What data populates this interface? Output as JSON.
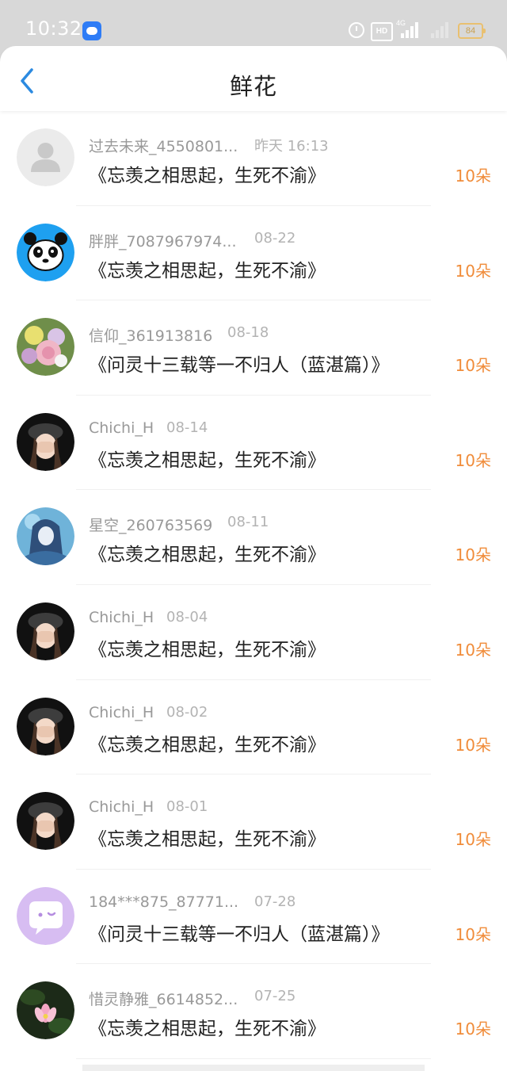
{
  "status_bar": {
    "time": "10:32",
    "network_label": "4G",
    "battery_level": "84",
    "hd_label": "HD"
  },
  "header": {
    "title": "鲜花"
  },
  "colors": {
    "accent_back": "#2c8ae0",
    "flower_count": "#f08c3a",
    "status_bar_bg": "#d8d8d8"
  },
  "items": [
    {
      "user": "过去未来_4550801...",
      "time": "昨天 16:13",
      "book": "《忘羡之相思起，生死不渝》",
      "count": "10朵",
      "avatar_icon": "default-user-avatar"
    },
    {
      "user": "胖胖_7087967974...",
      "time": "08-22",
      "book": "《忘羡之相思起，生死不渝》",
      "count": "10朵",
      "avatar_icon": "panda-avatar"
    },
    {
      "user": "信仰_361913816",
      "time": "08-18",
      "book": "《问灵十三载等一不归人（蓝湛篇）》",
      "count": "10朵",
      "avatar_icon": "flowers-avatar"
    },
    {
      "user": "Chichi_H",
      "time": "08-14",
      "book": "《忘羡之相思起，生死不渝》",
      "count": "10朵",
      "avatar_icon": "girl-cap-avatar"
    },
    {
      "user": "星空_260763569",
      "time": "08-11",
      "book": "《忘羡之相思起，生死不渝》",
      "count": "10朵",
      "avatar_icon": "anime-girl-avatar"
    },
    {
      "user": "Chichi_H",
      "time": "08-04",
      "book": "《忘羡之相思起，生死不渝》",
      "count": "10朵",
      "avatar_icon": "girl-cap-avatar"
    },
    {
      "user": "Chichi_H",
      "time": "08-02",
      "book": "《忘羡之相思起，生死不渝》",
      "count": "10朵",
      "avatar_icon": "girl-cap-avatar"
    },
    {
      "user": "Chichi_H",
      "time": "08-01",
      "book": "《忘羡之相思起，生死不渝》",
      "count": "10朵",
      "avatar_icon": "girl-cap-avatar"
    },
    {
      "user": "184***875_87771...",
      "time": "07-28",
      "book": "《问灵十三载等一不归人（蓝湛篇）》",
      "count": "10朵",
      "avatar_icon": "chat-bubble-avatar"
    },
    {
      "user": "惜灵静雅_6614852...",
      "time": "07-25",
      "book": "《忘羡之相思起，生死不渝》",
      "count": "10朵",
      "avatar_icon": "lotus-avatar"
    }
  ]
}
